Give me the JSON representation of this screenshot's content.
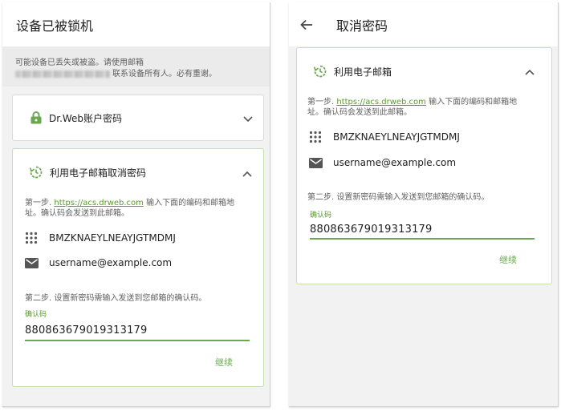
{
  "left": {
    "title": "设备已被锁机",
    "warning_line1": "可能设备已丢失或被盗。请使用邮箱",
    "warning_line2": "联系设备所有人。必有重谢。",
    "password_card_label": "Dr.Web账户密码",
    "email_card_label": "利用电子邮箱取消密码",
    "step1_prefix": "第一步.",
    "step1_link": "https://acs.drweb.com",
    "step1_suffix": "输入下面的编码和邮箱地",
    "step1_line2": "址。确认码会发送到此邮箱。",
    "code": "BMZKNAEYLNEAYJGTMDMJ",
    "email": "username@example.com",
    "step2": "第二步. 设置新密码需输入发送到您邮箱的确认码。",
    "field_label": "确认码",
    "field_value": "880863679019313179",
    "continue_label": "继续"
  },
  "right": {
    "title": "取消密码",
    "card_label": "利用电子邮箱",
    "step1_prefix": "第一步.",
    "step1_link": "https://acs.drweb.com",
    "step1_suffix": "输入下面的编码和邮箱地",
    "step1_line2": "址。确认码会发送到此邮箱。",
    "code": "BMZKNAEYLNEAYJGTMDMJ",
    "email": "username@example.com",
    "step2": "第二步. 设置新密码需输入发送到您邮箱的确认码。",
    "field_label": "确认码",
    "field_value": "880863679019313179",
    "continue_label": "继续"
  },
  "colors": {
    "accent": "#6aa84f",
    "link": "#5b9a2a",
    "active_border": "#c6e0b0"
  },
  "icons": {
    "lock": "lock-icon",
    "reset": "reset-icon",
    "keypad": "keypad-icon",
    "mail": "mail-icon",
    "back": "arrow-back-icon",
    "expand": "chevron-down-icon",
    "collapse": "chevron-up-icon"
  }
}
